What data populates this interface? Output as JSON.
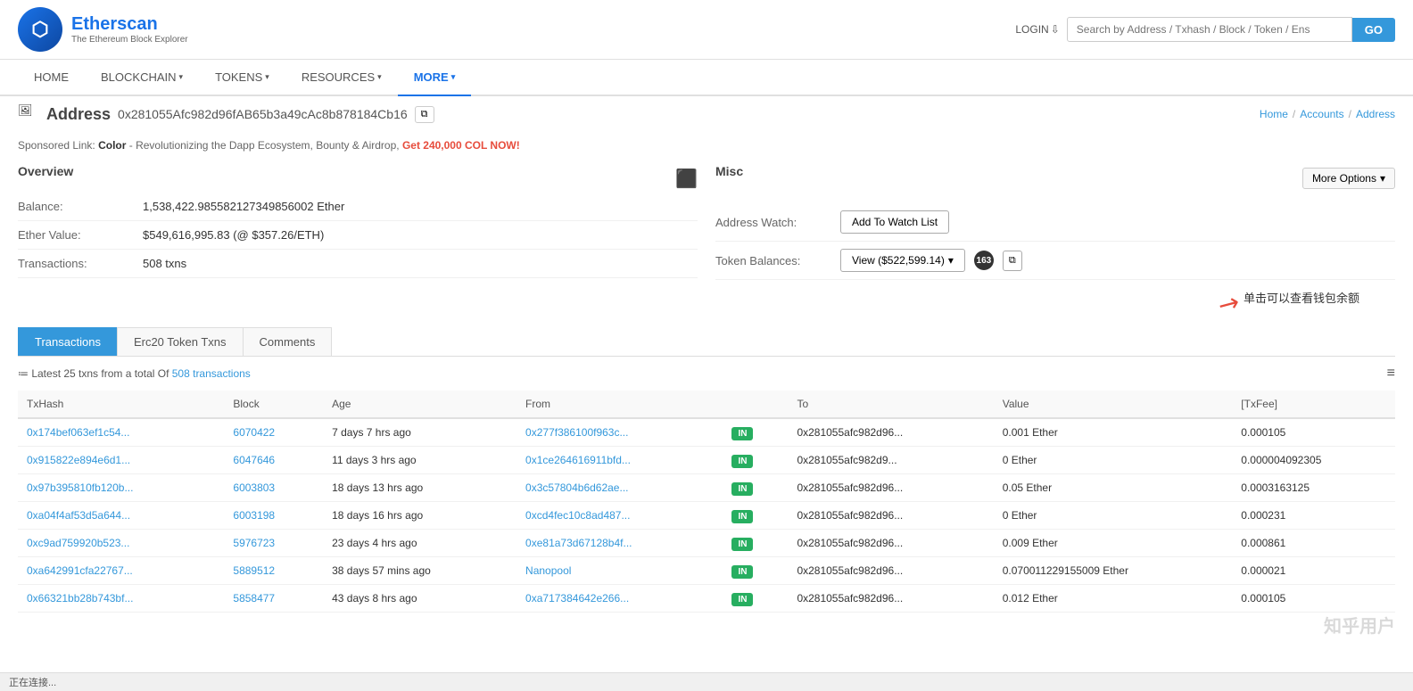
{
  "header": {
    "logo_text": "Etherscan",
    "logo_subtitle": "The Ethereum Block Explorer",
    "login_label": "LOGIN",
    "search_placeholder": "Search by Address / Txhash / Block / Token / Ens",
    "go_label": "GO"
  },
  "nav": {
    "items": [
      {
        "label": "HOME",
        "active": false,
        "has_caret": false
      },
      {
        "label": "BLOCKCHAIN",
        "active": false,
        "has_caret": true
      },
      {
        "label": "TOKENS",
        "active": false,
        "has_caret": true
      },
      {
        "label": "RESOURCES",
        "active": false,
        "has_caret": true
      },
      {
        "label": "MORE",
        "active": true,
        "has_caret": true
      }
    ]
  },
  "breadcrumb": {
    "home": "Home",
    "accounts": "Accounts",
    "current": "Address",
    "sep": "/"
  },
  "page": {
    "icon": "🖼",
    "title": "Address",
    "address": "0x281055Afc982d96fAB65b3a49cAc8b878184Cb16",
    "copy_title": "Copy address to clipboard"
  },
  "sponsored": {
    "prefix": "Sponsored Link:",
    "brand": "Color",
    "message": " - Revolutionizing the Dapp Ecosystem, Bounty & Airdrop,",
    "cta": " Get 240,000 COL NOW!"
  },
  "overview": {
    "title": "Overview",
    "balance_label": "Balance:",
    "balance_value": "1,538,422.985582127349856002 Ether",
    "ether_value_label": "Ether Value:",
    "ether_value": "$549,616,995.83 (@ $357.26/ETH)",
    "transactions_label": "Transactions:",
    "transactions_value": "508 txns"
  },
  "misc": {
    "title": "Misc",
    "more_options_label": "More Options",
    "address_watch_label": "Address Watch:",
    "add_to_watch_list": "Add To Watch List",
    "token_balances_label": "Token Balances:",
    "view_label": "View ($522,599.14)",
    "badge_count": "163",
    "annotation": "单击可以查看钱包余额"
  },
  "tabs": [
    {
      "label": "Transactions",
      "active": true
    },
    {
      "label": "Erc20 Token Txns",
      "active": false
    },
    {
      "label": "Comments",
      "active": false
    }
  ],
  "table": {
    "header_text_prefix": "Latest 25 txns from a total Of",
    "total_txns": "508 transactions",
    "columns": [
      "TxHash",
      "Block",
      "Age",
      "From",
      "",
      "To",
      "Value",
      "[TxFee]"
    ],
    "rows": [
      {
        "txhash": "0x174bef063ef1c54...",
        "block": "6070422",
        "age": "7 days 7 hrs ago",
        "from": "0x277f386100f963c...",
        "direction": "IN",
        "to": "0x281055afc982d96...",
        "value": "0.001 Ether",
        "txfee": "0.000105"
      },
      {
        "txhash": "0x915822e894e6d1...",
        "block": "6047646",
        "age": "11 days 3 hrs ago",
        "from": "0x1ce264616911bfd...",
        "direction": "IN",
        "to": "0x281055afc982d9...",
        "value": "0 Ether",
        "txfee": "0.000004092305"
      },
      {
        "txhash": "0x97b395810fb120b...",
        "block": "6003803",
        "age": "18 days 13 hrs ago",
        "from": "0x3c57804b6d62ae...",
        "direction": "IN",
        "to": "0x281055afc982d96...",
        "value": "0.05 Ether",
        "txfee": "0.0003163125"
      },
      {
        "txhash": "0xa04f4af53d5a644...",
        "block": "6003198",
        "age": "18 days 16 hrs ago",
        "from": "0xcd4fec10c8ad487...",
        "direction": "IN",
        "to": "0x281055afc982d96...",
        "value": "0 Ether",
        "txfee": "0.000231"
      },
      {
        "txhash": "0xc9ad759920b523...",
        "block": "5976723",
        "age": "23 days 4 hrs ago",
        "from": "0xe81a73d67128b4f...",
        "direction": "IN",
        "to": "0x281055afc982d96...",
        "value": "0.009 Ether",
        "txfee": "0.000861"
      },
      {
        "txhash": "0xa642991cfa22767...",
        "block": "5889512",
        "age": "38 days 57 mins ago",
        "from": "Nanopool",
        "direction": "IN",
        "to": "0x281055afc982d96...",
        "value": "0.070011229155009 Ether",
        "txfee": "0.000021"
      },
      {
        "txhash": "0x66321bb28b743bf...",
        "block": "5858477",
        "age": "43 days 8 hrs ago",
        "from": "0xa717384642e266...",
        "direction": "IN",
        "to": "0x281055afc982d96...",
        "value": "0.012 Ether",
        "txfee": "0.000105"
      }
    ]
  },
  "status_bar": {
    "text": "正在连接..."
  },
  "watermark": "知乎用户"
}
